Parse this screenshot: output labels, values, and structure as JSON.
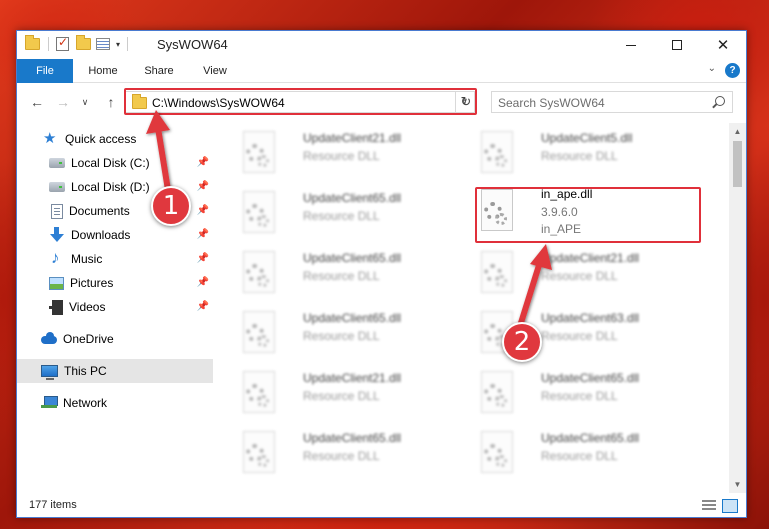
{
  "window": {
    "title": "SysWOW64",
    "controls": {
      "minimize": "—",
      "maximize": "□",
      "close": "✕"
    }
  },
  "ribbon": {
    "tabs": [
      "File",
      "Home",
      "Share",
      "View"
    ],
    "help": "?"
  },
  "nav": {
    "address": "C:\\Windows\\SysWOW64",
    "search_placeholder": "Search SysWOW64"
  },
  "sidebar": {
    "items": [
      {
        "label": "Quick access",
        "icon": "star-icon",
        "pinned": false
      },
      {
        "label": "Local Disk (C:)",
        "icon": "disk-icon",
        "pinned": true
      },
      {
        "label": "Local Disk (D:)",
        "icon": "disk-icon",
        "pinned": true
      },
      {
        "label": "Documents",
        "icon": "documents-icon",
        "pinned": true
      },
      {
        "label": "Downloads",
        "icon": "downloads-icon",
        "pinned": true
      },
      {
        "label": "Music",
        "icon": "music-icon",
        "pinned": true
      },
      {
        "label": "Pictures",
        "icon": "pictures-icon",
        "pinned": true
      },
      {
        "label": "Videos",
        "icon": "videos-icon",
        "pinned": true
      },
      {
        "label": "OneDrive",
        "icon": "onedrive-icon",
        "pinned": false
      },
      {
        "label": "This PC",
        "icon": "this-pc-icon",
        "pinned": false,
        "selected": true
      },
      {
        "label": "Network",
        "icon": "network-icon",
        "pinned": false
      }
    ]
  },
  "files": {
    "left": [
      {
        "name": "UpdateClient21.dll",
        "type": "Resource DLL"
      },
      {
        "name": "UpdateClient65.dll",
        "type": "Resource DLL"
      },
      {
        "name": "UpdateClient65.dll",
        "type": "Resource DLL"
      },
      {
        "name": "UpdateClient65.dll",
        "type": "Resource DLL"
      },
      {
        "name": "UpdateClient21.dll",
        "type": "Resource DLL"
      },
      {
        "name": "UpdateClient65.dll",
        "type": "Resource DLL"
      }
    ],
    "right": [
      {
        "name": "UpdateClient5.dll",
        "type": "Resource DLL"
      },
      {
        "name": "in_ape.dll",
        "version": "3.9.6.0",
        "type": "in_APE",
        "highlighted": true
      },
      {
        "name": "UpdateClient21.dll",
        "type": "Resource DLL"
      },
      {
        "name": "UpdateClient63.dll",
        "type": "Resource DLL"
      },
      {
        "name": "UpdateClient65.dll",
        "type": "Resource DLL"
      },
      {
        "name": "UpdateClient65.dll",
        "type": "Resource DLL"
      }
    ]
  },
  "status": {
    "item_count": "177 items"
  },
  "annotations": {
    "marker1": "1",
    "marker2": "2",
    "color": "#e0383e"
  }
}
